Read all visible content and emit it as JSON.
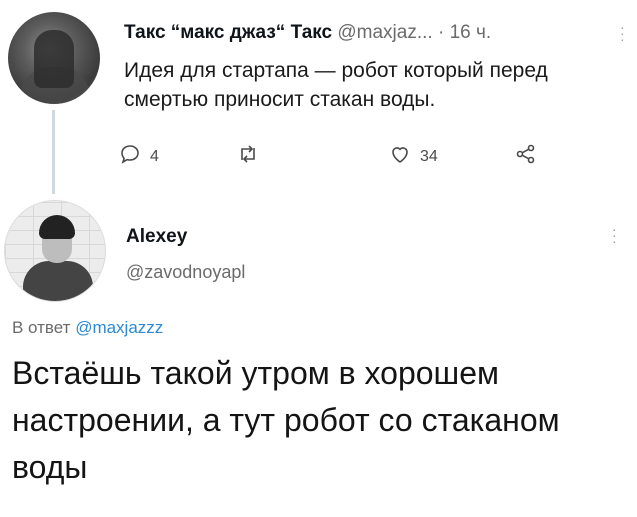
{
  "tweet1": {
    "display_name": "Такс “макс джаз“ Такс",
    "handle": "@maxjaz...",
    "time": "· 16 ч.",
    "text": "Идея для стартапа — робот который перед смертью приносит стакан воды.",
    "reply_count": "4",
    "retweet_count": "",
    "like_count": "34"
  },
  "tweet2": {
    "display_name": "Alexey",
    "handle": "@zavodnoyapl",
    "reply_prefix": "В ответ",
    "reply_to": "@maxjazzz",
    "text": "Встаёшь такой утром в хорошем настроении, а тут робот со стаканом воды"
  },
  "icons": {
    "reply": "reply-icon",
    "retweet": "retweet-icon",
    "like": "heart-icon",
    "share": "share-icon",
    "more": "more-icon"
  },
  "colors": {
    "link": "#2b8ad1",
    "secondary_text": "#6b6b6b",
    "thread_line": "#cfd9de"
  }
}
